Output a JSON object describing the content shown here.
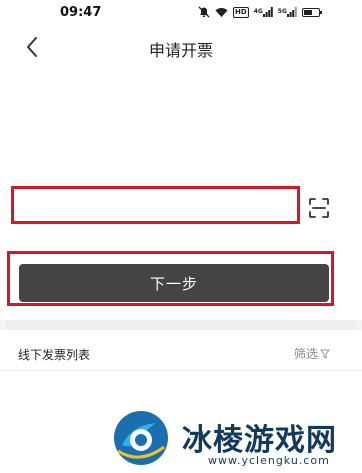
{
  "status_bar": {
    "time": "09:47",
    "icons": [
      "mute-icon",
      "wifi-icon",
      "hd-badge",
      "signal-4g-icon",
      "signal-5g-icon",
      "battery-icon"
    ],
    "hd_label": "HD",
    "net1_label": "4G",
    "net2_label": "5G",
    "battery_level": 0.6
  },
  "nav": {
    "title": "申请开票"
  },
  "form": {
    "input_value": "",
    "input_placeholder": "",
    "next_button_label": "下一步",
    "highlight_color": "#d7162a",
    "button_color": "#444444"
  },
  "list": {
    "title": "线下发票列表",
    "filter_label": "筛选"
  },
  "watermark": {
    "name": "冰棱游戏网",
    "url": "www.yclengku.com"
  }
}
